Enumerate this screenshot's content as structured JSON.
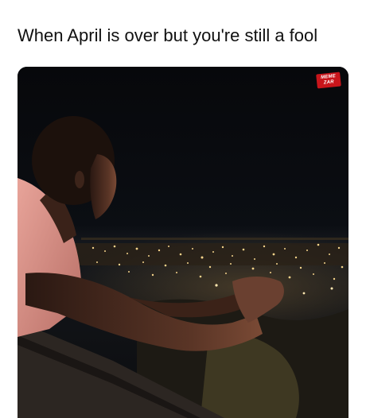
{
  "post": {
    "caption": "When April is over but you're still a fool"
  },
  "image": {
    "watermark": {
      "line1": "MEME",
      "line2": "ZAR",
      "color": "#c8151b"
    }
  }
}
